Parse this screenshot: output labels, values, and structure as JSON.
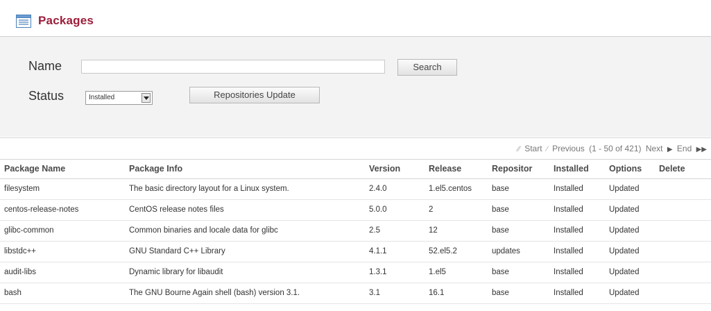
{
  "header": {
    "title": "Packages",
    "icon": "package-list-icon"
  },
  "filter": {
    "name_label": "Name",
    "name_value": "",
    "search_button": "Search",
    "status_label": "Status",
    "status_selected": "Installed",
    "repositories_update_button": "Repositories Update"
  },
  "pager": {
    "start": "Start",
    "previous": "Previous",
    "range": "(1 - 50 of 421)",
    "next": "Next",
    "end": "End"
  },
  "table": {
    "columns": [
      "Package Name",
      "Package Info",
      "Version",
      "Release",
      "Repositor",
      "Installed",
      "Options",
      "Delete"
    ],
    "rows": [
      [
        "filesystem",
        "The basic directory layout for a Linux system.",
        "2.4.0",
        "1.el5.centos",
        "base",
        "Installed",
        "Updated",
        ""
      ],
      [
        "centos-release-notes",
        "CentOS release notes files",
        "5.0.0",
        "2",
        "base",
        "Installed",
        "Updated",
        ""
      ],
      [
        "glibc-common",
        "Common binaries and locale data for glibc",
        "2.5",
        "12",
        "base",
        "Installed",
        "Updated",
        ""
      ],
      [
        "libstdc++",
        "GNU Standard C++ Library",
        "4.1.1",
        "52.el5.2",
        "updates",
        "Installed",
        "Updated",
        ""
      ],
      [
        "audit-libs",
        "Dynamic library for libaudit",
        "1.3.1",
        "1.el5",
        "base",
        "Installed",
        "Updated",
        ""
      ],
      [
        "bash",
        "The GNU Bourne Again shell (bash) version 3.1.",
        "3.1",
        "16.1",
        "base",
        "Installed",
        "Updated",
        ""
      ]
    ]
  }
}
